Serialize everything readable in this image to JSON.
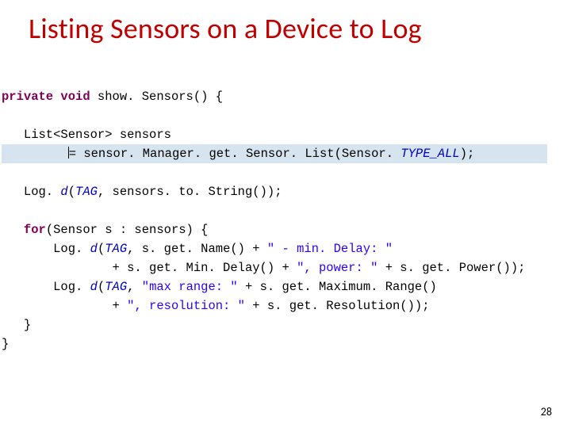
{
  "title": "Listing Sensors on a Device to Log",
  "code": {
    "l1": {
      "kw1": "private void",
      "name": " show. Sensors() {"
    },
    "l2": {
      "type": "List<Sensor>",
      "var": " sensors"
    },
    "l3": {
      "assign": "= ",
      "call": "sensor. Manager. get. Sensor. List(Sensor. ",
      "const": "TYPE_ALL",
      "close": ");"
    },
    "l4": {
      "pre": "Log. ",
      "d": "d",
      "open": "(",
      "tag": "TAG",
      "rest": ", sensors. to. String());"
    },
    "l5": {
      "kw": "for",
      "rest": "(Sensor s : sensors) {"
    },
    "l6": {
      "pre": "    Log. ",
      "d": "d",
      "open": "(",
      "tag": "TAG",
      "mid": ", s. get. Name() + ",
      "s1": "\" - min. Delay: \""
    },
    "l7": {
      "pre": "            + s. get. Min. Delay() + ",
      "s1": "\", power: \"",
      "rest": " + s. get. Power());"
    },
    "l8": {
      "pre": "    Log. ",
      "d": "d",
      "open": "(",
      "tag": "TAG",
      "mid": ", ",
      "s1": "\"max range: \"",
      "rest": " + s. get. Maximum. Range()"
    },
    "l9": {
      "pre": "            + ",
      "s1": "\", resolution: \"",
      "rest": " + s. get. Resolution());"
    },
    "l10": "}",
    "l11": "}"
  },
  "page_number": "28"
}
